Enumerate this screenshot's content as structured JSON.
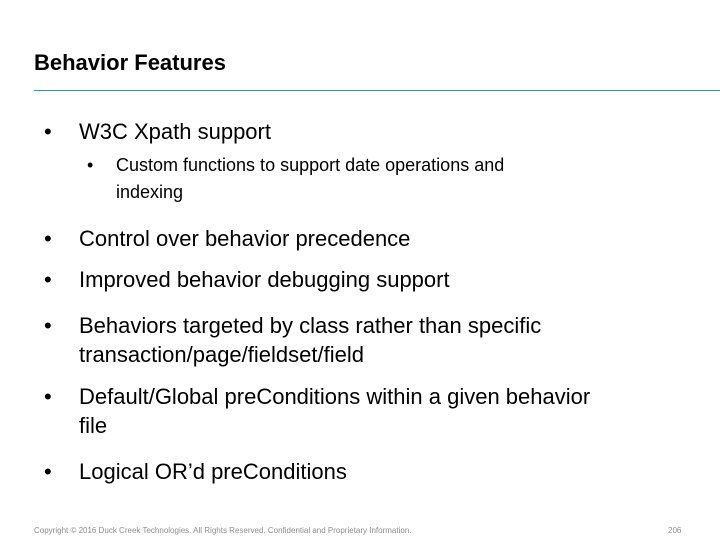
{
  "slide": {
    "title": "Behavior Features",
    "bullets": [
      {
        "text_lines": [
          "W3C Xpath support"
        ],
        "sub": [
          {
            "text_lines": [
              "Custom functions to support date operations and",
              "indexing"
            ]
          }
        ]
      },
      {
        "text_lines": [
          "Control over behavior precedence"
        ]
      },
      {
        "text_lines": [
          "Improved behavior debugging support"
        ]
      },
      {
        "text_lines": [
          "Behaviors targeted by class rather than specific",
          "transaction/page/fieldset/field"
        ]
      },
      {
        "text_lines": [
          "Default/Global preConditions within a given behavior",
          "file"
        ]
      },
      {
        "text_lines": [
          "Logical OR’d preConditions"
        ]
      }
    ],
    "bullet_glyph": "•"
  },
  "footer": {
    "copyright": "Copyright © 2016 Duck Creek Technologies. All Rights Reserved. Confidential and Proprietary Information.",
    "page_number": "206"
  },
  "colors": {
    "title_rule": "#1b9bb0",
    "footer_text": "#8c8c8c"
  }
}
